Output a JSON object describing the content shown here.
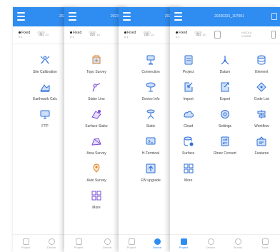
{
  "status": {
    "fix": "Fixed",
    "fix_sub": "0.1",
    "sat_sub": "10"
  },
  "panel1": {
    "title": "2023",
    "items": [
      {
        "label": "Site Calibration",
        "icon": "calibration-icon"
      },
      {
        "label": "Earthwork Calc",
        "icon": "earthwork-icon"
      },
      {
        "label": "FTP",
        "icon": "ftp-icon"
      }
    ],
    "nav": [
      {
        "label": "Project"
      },
      {
        "label": "Device"
      }
    ]
  },
  "panel2": {
    "title": "2023",
    "items": [
      {
        "label": "Topo Survey",
        "icon": "topo-survey-icon"
      },
      {
        "label": "Stake Line",
        "icon": "stake-line-icon"
      },
      {
        "label": "Surface Stake",
        "icon": "surface-stake-icon"
      },
      {
        "label": "Area Survey",
        "icon": "area-survey-icon"
      },
      {
        "label": "Auto Survey",
        "icon": "auto-survey-icon"
      },
      {
        "label": "More",
        "icon": "more-icon"
      }
    ],
    "nav": [
      {
        "label": "Project"
      },
      {
        "label": "Device"
      }
    ]
  },
  "panel3": {
    "title": "2023",
    "items": [
      {
        "label": "Connection",
        "icon": "connection-icon"
      },
      {
        "label": "Device Info",
        "icon": "device-info-icon"
      },
      {
        "label": "Static",
        "icon": "static-icon"
      },
      {
        "label": "H-Terminal",
        "icon": "terminal-icon"
      },
      {
        "label": "FW upgrade",
        "icon": "fw-upgrade-icon"
      }
    ],
    "nav": [
      {
        "label": "Project"
      },
      {
        "label": "Device"
      }
    ]
  },
  "panel4": {
    "title": "20230321_107001",
    "hdop": "H:0.014",
    "vdop": "V:0.039",
    "items": [
      {
        "label": "Project",
        "icon": "project-icon"
      },
      {
        "label": "Datum",
        "icon": "datum-icon"
      },
      {
        "label": "Element",
        "icon": "element-icon"
      },
      {
        "label": "Import",
        "icon": "import-icon"
      },
      {
        "label": "Export",
        "icon": "export-icon"
      },
      {
        "label": "Code List",
        "icon": "code-list-icon"
      },
      {
        "label": "Cloud",
        "icon": "cloud-icon"
      },
      {
        "label": "Settings",
        "icon": "settings-icon"
      },
      {
        "label": "Workflow",
        "icon": "workflow-icon"
      },
      {
        "label": "Surface",
        "icon": "surface-icon"
      },
      {
        "label": "Rinex Convert",
        "icon": "rinex-convert-icon"
      },
      {
        "label": "Features",
        "icon": "features-icon"
      },
      {
        "label": "More",
        "icon": "more-icon"
      }
    ],
    "nav": [
      {
        "label": "Project"
      },
      {
        "label": "Device"
      },
      {
        "label": "Survey"
      },
      {
        "label": "Tools"
      }
    ]
  },
  "colors": {
    "accent": "#2f8cf0",
    "icon_stroke": "#2f6fd6",
    "icon_fill": "#cfe0fb"
  }
}
